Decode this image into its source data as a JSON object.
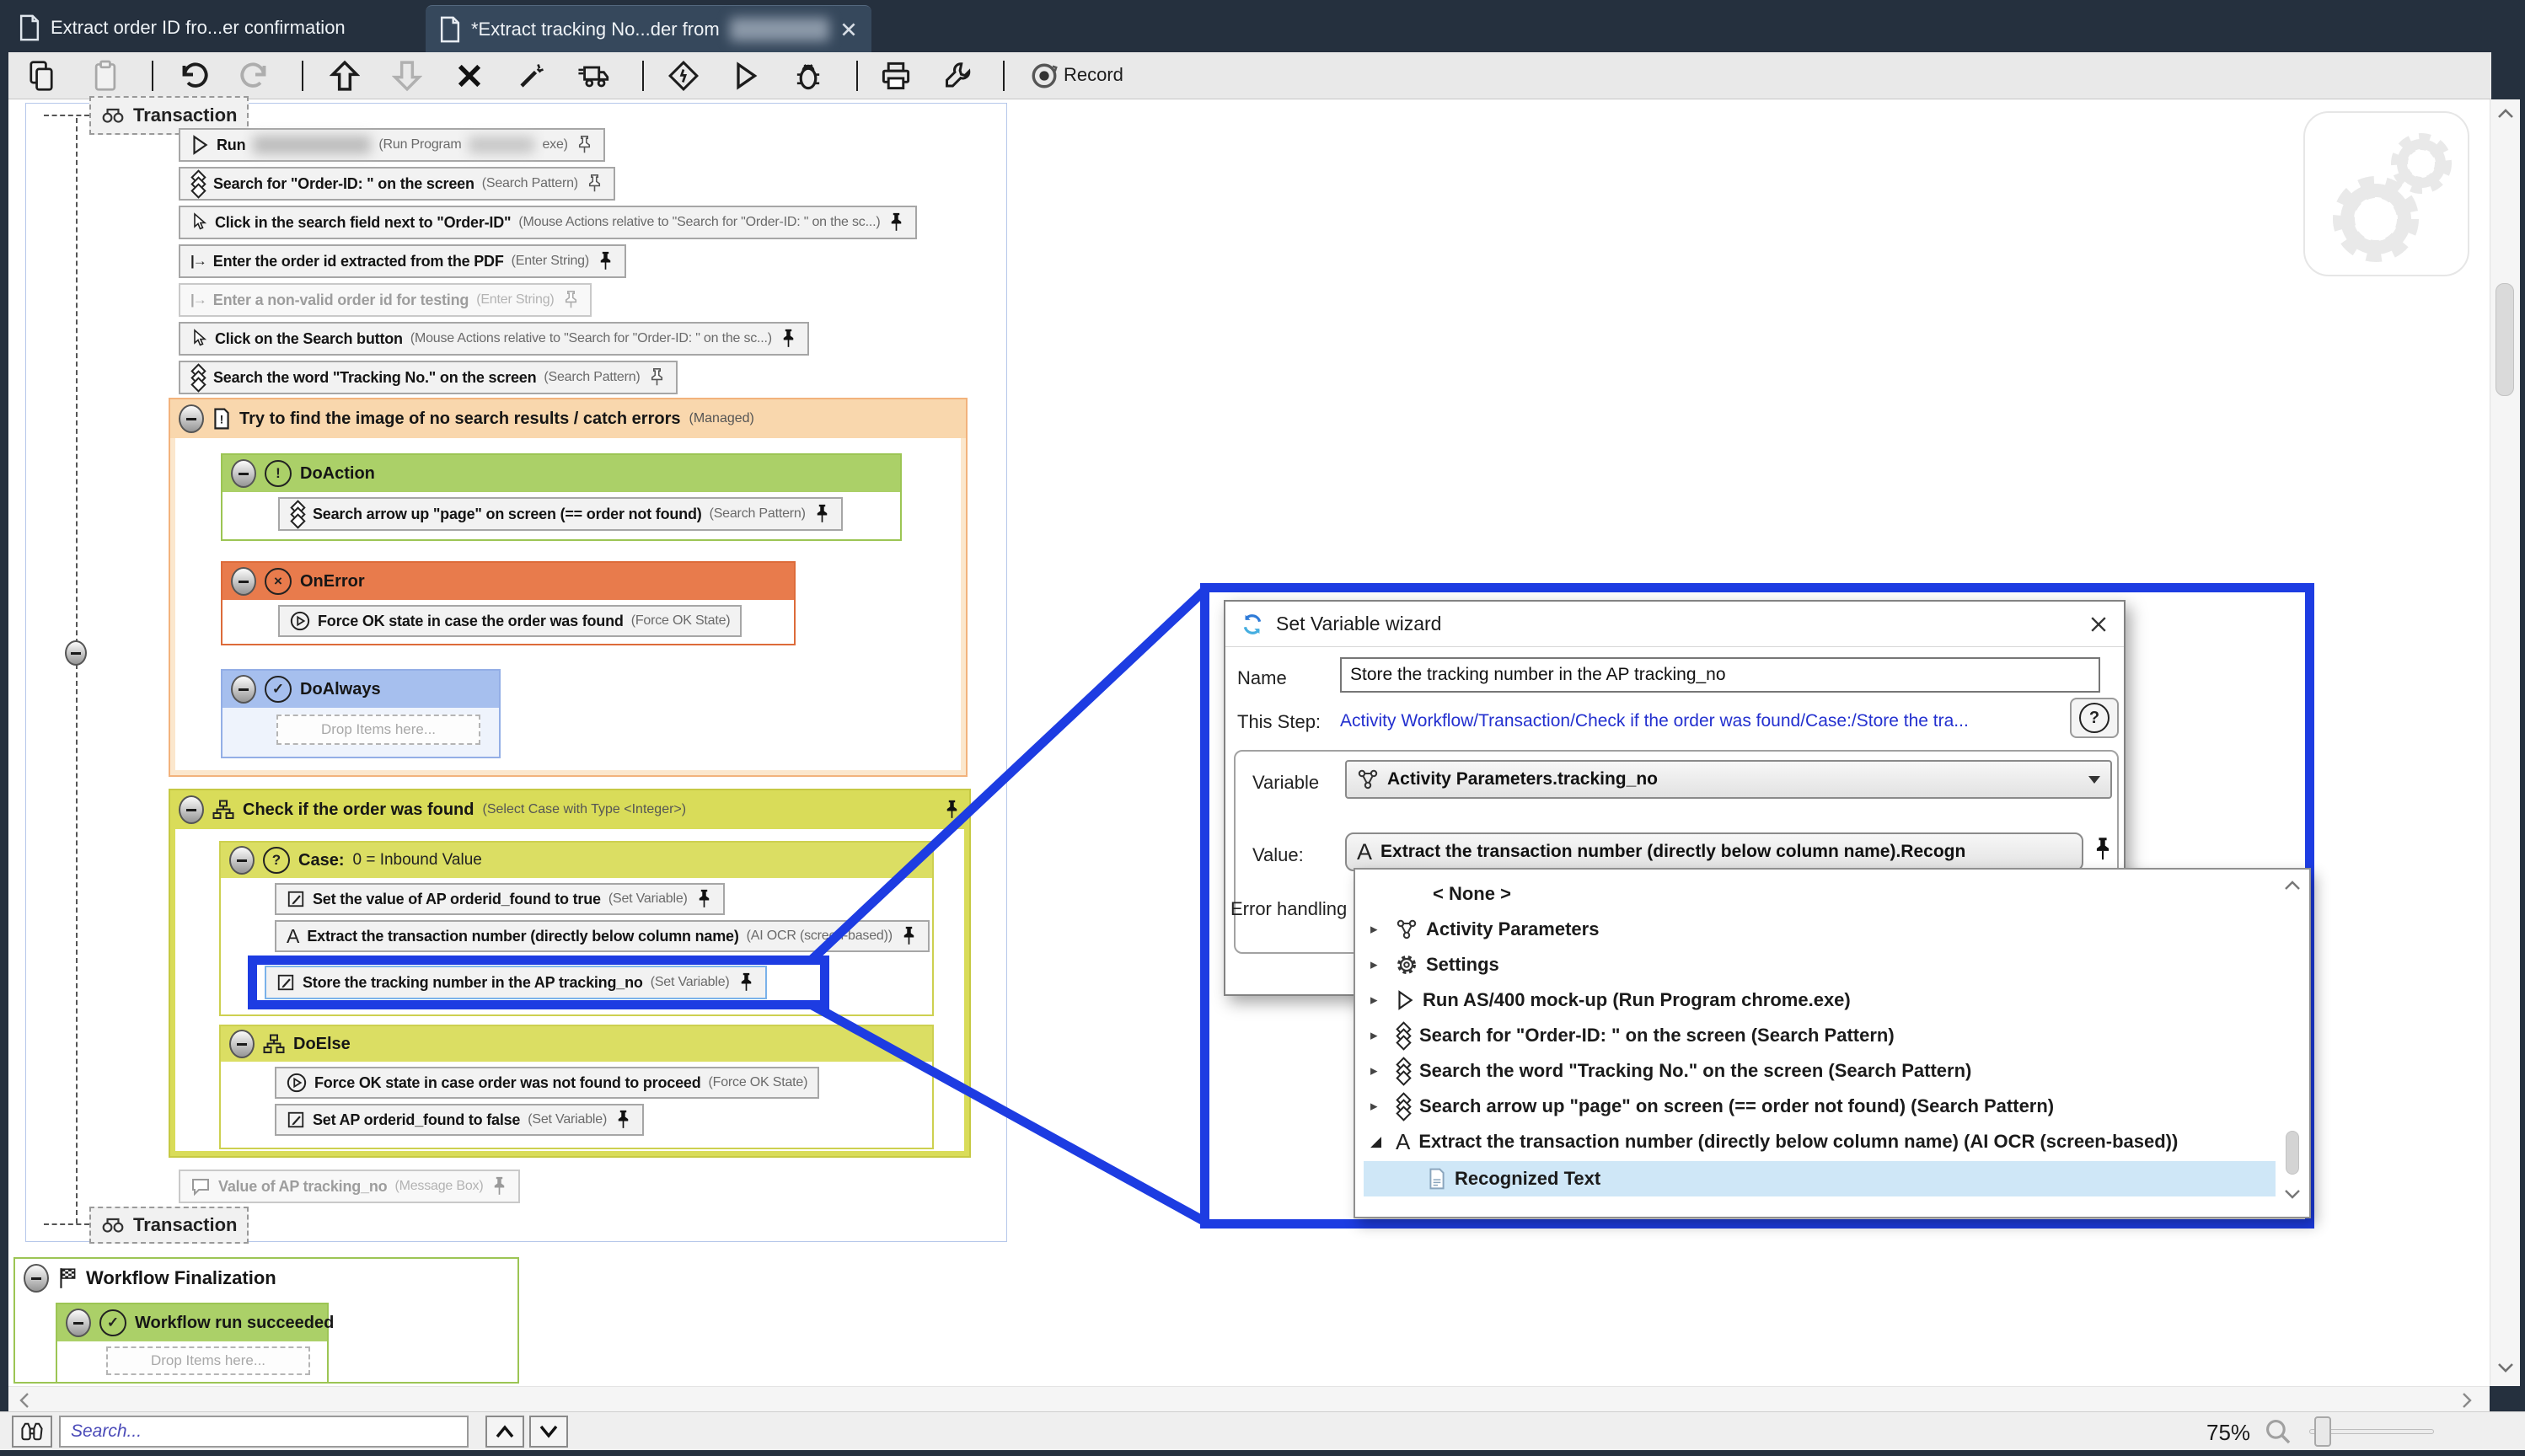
{
  "tabs": {
    "tab1": "Extract order ID fro...er confirmation",
    "tab2": "*Extract tracking No...der from"
  },
  "toolbar": {
    "record_label": "Record"
  },
  "workflow": {
    "transaction_label": "Transaction",
    "run": {
      "title": "Run",
      "suffix_pre": "(Run Program",
      "suffix_post": "exe)"
    },
    "search_order": {
      "title": "Search for \"Order-ID: \" on the screen",
      "suffix": "(Search Pattern)"
    },
    "click_field": {
      "title": "Click in the search field next to \"Order-ID\"",
      "suffix": "(Mouse Actions relative to \"Search for \"Order-ID: \" on the sc...)"
    },
    "enter_order": {
      "title": "Enter the order id extracted from the PDF",
      "suffix": "(Enter String)"
    },
    "enter_nonvalid": {
      "title": "Enter a non-valid order id for testing",
      "suffix": "(Enter String)"
    },
    "click_button": {
      "title": "Click on the Search button",
      "suffix": "(Mouse Actions relative to \"Search for \"Order-ID: \" on the sc...)"
    },
    "search_tracking": {
      "title": "Search the word \"Tracking No.\" on the screen",
      "suffix": "(Search Pattern)"
    },
    "try_block": {
      "title": "Try to find the image of no search results / catch errors",
      "suffix": "(Managed)"
    },
    "doaction": {
      "title": "DoAction"
    },
    "search_arrow": {
      "title": "Search arrow up \"page\" on screen (== order not found)",
      "suffix": "(Search Pattern)"
    },
    "onerror": {
      "title": "OnError"
    },
    "force_ok_found": {
      "title": "Force OK state in case the order was found",
      "suffix": "(Force OK State)"
    },
    "doalways": {
      "title": "DoAlways"
    },
    "drop_items": "Drop Items here...",
    "check_block": {
      "title": "Check if the order was found",
      "suffix": "(Select Case with Type <Integer>)"
    },
    "case_block": {
      "title": "Case:",
      "suffix": "0 = Inbound Value"
    },
    "set_true": {
      "title": "Set the value of AP orderid_found to true",
      "suffix": "(Set Variable)"
    },
    "extract": {
      "title": "Extract the transaction number (directly below column name)",
      "suffix": "(AI OCR (screen-based))"
    },
    "store": {
      "title": "Store the tracking number in the AP tracking_no",
      "suffix": "(Set Variable)"
    },
    "doelse": {
      "title": "DoElse"
    },
    "force_ok_notfound": {
      "title": "Force OK state in case order was not found to proceed",
      "suffix": "(Force OK State)"
    },
    "set_false": {
      "title": "Set AP orderid_found to false",
      "suffix": "(Set Variable)"
    },
    "msgbox": {
      "title": "Value of AP tracking_no",
      "suffix": "(Message Box)"
    },
    "finalization": {
      "title": "Workflow Finalization"
    },
    "succeeded": {
      "title": "Workflow run succeeded"
    }
  },
  "dialog": {
    "title": "Set Variable wizard",
    "name_label": "Name",
    "name_value": "Store the tracking number in the AP tracking_no",
    "step_label": "This Step:",
    "step_link": "Activity Workflow/Transaction/Check if the order was found/Case:/Store the tra...",
    "help_label": "?",
    "variable_label": "Variable",
    "variable_value": "Activity Parameters.tracking_no",
    "value_label": "Value:",
    "value_text": "Extract the transaction number (directly below column name).Recogn",
    "error_handling_label": "Error handling"
  },
  "popup": {
    "items": [
      {
        "label": "< None >"
      },
      {
        "label": "Activity Parameters"
      },
      {
        "label": "Settings"
      },
      {
        "label": "Run AS/400 mock-up  (Run Program chrome.exe)"
      },
      {
        "label": "Search for \"Order-ID: \" on the screen (Search Pattern)"
      },
      {
        "label": "Search the word \"Tracking No.\" on the screen (Search Pattern)"
      },
      {
        "label": "Search arrow up \"page\" on screen (== order not found) (Search Pattern)"
      },
      {
        "label": "Extract the transaction number (directly below column name) (AI OCR (screen-based))"
      },
      {
        "label": "Recognized Text"
      }
    ]
  },
  "statusbar": {
    "search_placeholder": "Search...",
    "zoom_level": "75%"
  },
  "colors": {
    "titlebar": "#25303e",
    "active_tab": "#36485c",
    "toolbar": "#e9e9e9",
    "callout_blue": "#1d3ce2",
    "selection_blue": "#7ab2ea",
    "try_header": "#f9d7ad",
    "try_body": "#fbe7cd",
    "green_header": "#abd068",
    "orange_header": "#e87b4c",
    "blue_header": "#a6bfee",
    "case_container": "#d9dc59",
    "case_header": "#dbde63",
    "popup_selected": "#cfe7f7",
    "link_blue": "#2330cf"
  }
}
